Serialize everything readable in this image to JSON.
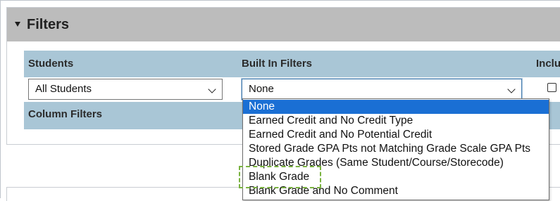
{
  "filters_panel": {
    "title": "Filters",
    "headers": {
      "students": "Students",
      "built_in_filters": "Built In Filters",
      "include": "Inclu"
    },
    "students_select_value": "All Students",
    "built_in_select_value": "None",
    "column_filters_label": "Column Filters",
    "include_checked": false
  },
  "dropdown": {
    "options": [
      "None",
      "Earned Credit and No Credit Type",
      "Earned Credit and No Potential Credit",
      "Stored Grade GPA Pts not Matching Grade Scale GPA Pts",
      "Duplicate Grades (Same Student/Course/Storecode)",
      "Blank Grade",
      "Blank Grade and No Comment"
    ],
    "selected_index": 0,
    "highlighted_option": "Blank Grade"
  },
  "colors": {
    "header_gray": "#bcbcbc",
    "table_blue": "#a9c6d6",
    "selected_blue": "#1a6fd4",
    "highlight_green": "#7ab340"
  }
}
